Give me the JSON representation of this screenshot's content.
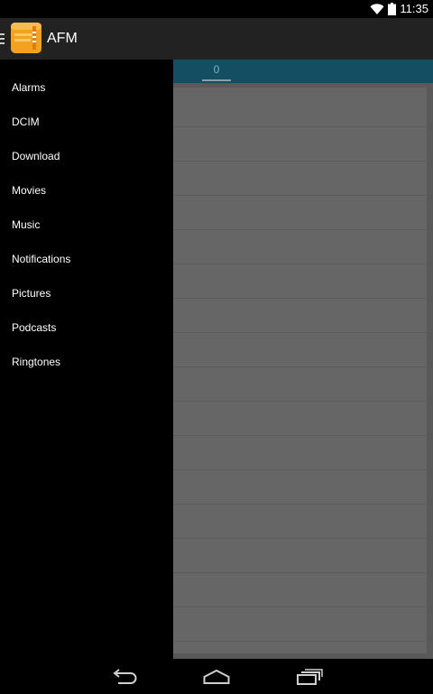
{
  "status_bar": {
    "time": "11:35",
    "icons": [
      "wifi-icon",
      "battery-icon"
    ]
  },
  "action_bar": {
    "title": "AFM",
    "icons": [
      "hamburger-icon",
      "app-icon"
    ]
  },
  "tabs": [
    {
      "label": "0"
    }
  ],
  "drawer": {
    "items": [
      {
        "label": "Alarms"
      },
      {
        "label": "DCIM"
      },
      {
        "label": "Download"
      },
      {
        "label": "Movies"
      },
      {
        "label": "Music"
      },
      {
        "label": "Notifications"
      },
      {
        "label": "Pictures"
      },
      {
        "label": "Podcasts"
      },
      {
        "label": "Ringtones"
      }
    ]
  },
  "nav_bar": {
    "icons": [
      "back-icon",
      "home-icon",
      "recents-icon"
    ]
  },
  "colors": {
    "action_bar": "#222222",
    "tab_bar": "#134f62",
    "list_bg": "#666666",
    "app_icon": "#f3a21e"
  }
}
